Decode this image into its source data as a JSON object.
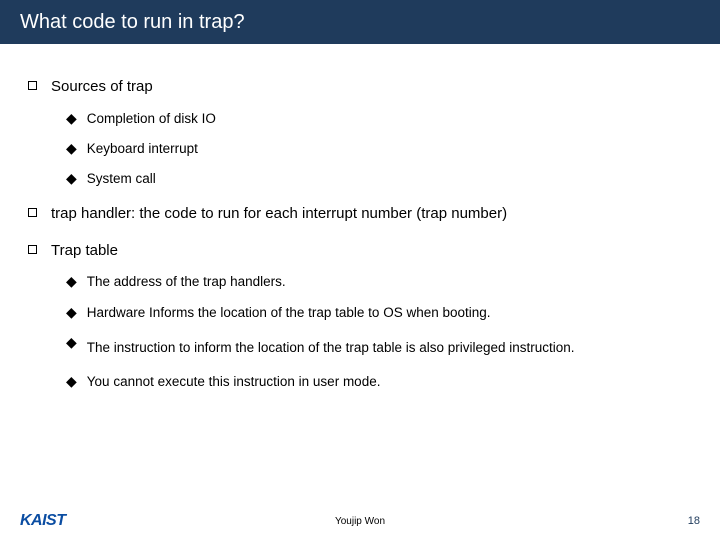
{
  "title": "What code to run in trap?",
  "items": {
    "sources": {
      "label": "Sources of trap",
      "subs": {
        "a": "Completion of disk IO",
        "b": "Keyboard interrupt",
        "c": "System call"
      }
    },
    "handler": {
      "label": "trap handler: the code to run for each interrupt number (trap number)"
    },
    "table": {
      "label": "Trap table",
      "subs": {
        "a": "The address of the trap handlers.",
        "b": "Hardware Informs the location of the trap table to OS when booting.",
        "c": "The instruction to inform the location of the trap table is also privileged instruction.",
        "d": "You cannot execute this instruction in user mode."
      }
    }
  },
  "footer": {
    "logo": "KAIST",
    "author": "Youjip Won",
    "page": "18"
  }
}
